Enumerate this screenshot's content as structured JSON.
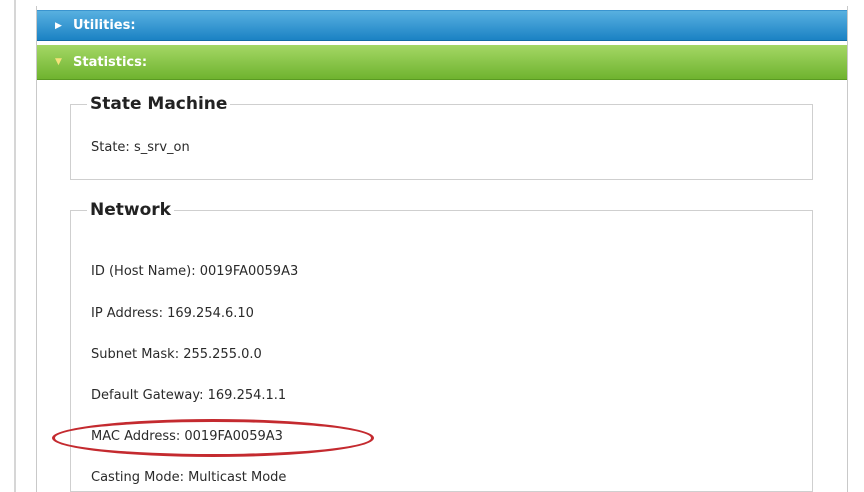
{
  "accordion": {
    "utilities_label": "Utilities:",
    "statistics_label": "Statistics:"
  },
  "state_machine": {
    "title": "State Machine",
    "state_label": "State:",
    "state_value": "s_srv_on"
  },
  "network": {
    "title": "Network",
    "rows": [
      {
        "label": "ID (Host Name):",
        "value": "0019FA0059A3"
      },
      {
        "label": "IP Address:",
        "value": "169.254.6.10"
      },
      {
        "label": "Subnet Mask:",
        "value": "255.255.0.0"
      },
      {
        "label": "Default Gateway:",
        "value": "169.254.1.1"
      },
      {
        "label": "MAC Address:",
        "value": "0019FA0059A3"
      },
      {
        "label": "Casting Mode:",
        "value": "Multicast Mode"
      }
    ]
  },
  "colors": {
    "utilities_header": "#1b82c4",
    "statistics_header": "#6fb32f",
    "highlight": "#c42a2f"
  }
}
